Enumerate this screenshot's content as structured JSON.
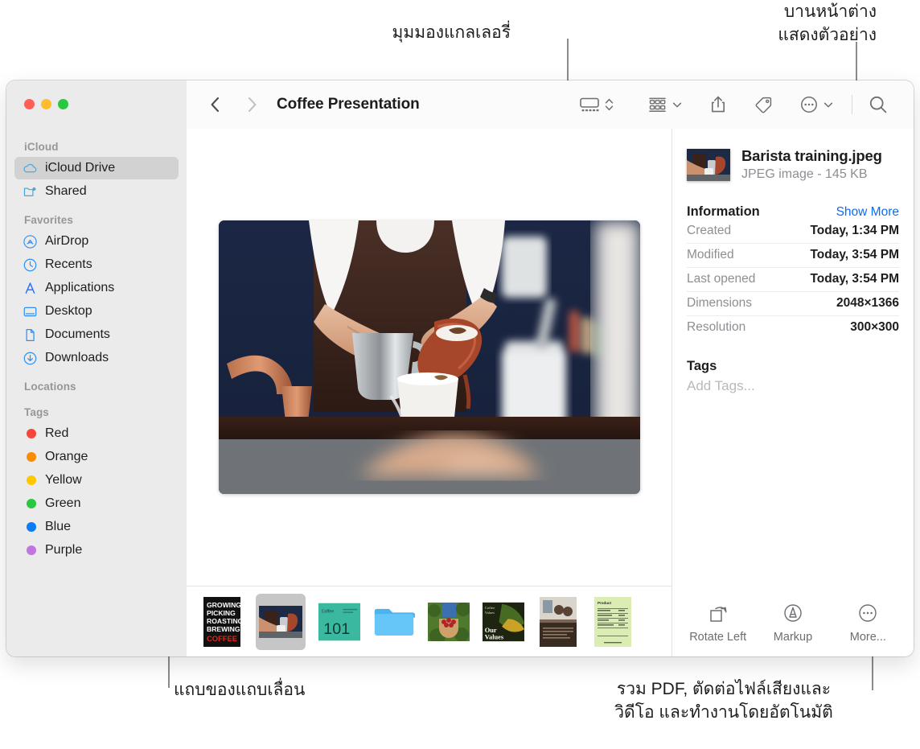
{
  "annotations": [
    {
      "id": "gallery-view",
      "text": "มุมมองแกลเลอรี่"
    },
    {
      "id": "preview-pane",
      "text": "บานหน้าต่าง\nแสดงตัวอย่าง"
    },
    {
      "id": "scrubber-bar",
      "text": "แถบของแถบเลื่อน"
    },
    {
      "id": "quick-actions",
      "text": "รวม PDF, ตัดต่อไฟล์เสียงและ\nวิดีโอ และทำงานโดยอัตโนมัติ"
    }
  ],
  "window": {
    "traffic_lights": [
      {
        "name": "close",
        "color": "#ff5f57"
      },
      {
        "name": "minimize",
        "color": "#febc2e"
      },
      {
        "name": "zoom",
        "color": "#28c840"
      }
    ]
  },
  "toolbar": {
    "back_icon": "chevron-left",
    "forward_icon": "chevron-right",
    "title": "Coffee Presentation",
    "view_icon": "gallery-view-icon",
    "view_stepper_icon": "up-down-chevrons",
    "group_icon": "group-items-icon",
    "share_icon": "share-icon",
    "tag_icon": "tag-icon",
    "more_icon": "ellipsis-circle-icon",
    "search_icon": "search-icon"
  },
  "sidebar": {
    "sections": [
      {
        "title": "iCloud",
        "items": [
          {
            "label": "iCloud Drive",
            "icon": "cloud-icon",
            "selected": true
          },
          {
            "label": "Shared",
            "icon": "shared-folder-icon",
            "selected": false
          }
        ]
      },
      {
        "title": "Favorites",
        "items": [
          {
            "label": "AirDrop",
            "icon": "airdrop-icon",
            "selected": false
          },
          {
            "label": "Recents",
            "icon": "clock-icon",
            "selected": false
          },
          {
            "label": "Applications",
            "icon": "applications-icon",
            "selected": false
          },
          {
            "label": "Desktop",
            "icon": "desktop-icon",
            "selected": false
          },
          {
            "label": "Documents",
            "icon": "document-icon",
            "selected": false
          },
          {
            "label": "Downloads",
            "icon": "downloads-icon",
            "selected": false
          }
        ]
      },
      {
        "title": "Locations",
        "items": []
      },
      {
        "title": "Tags",
        "items": [
          {
            "label": "Red",
            "icon": "tag-dot",
            "color": "#f7453c"
          },
          {
            "label": "Orange",
            "icon": "tag-dot",
            "color": "#fb8c00"
          },
          {
            "label": "Yellow",
            "icon": "tag-dot",
            "color": "#fdc800"
          },
          {
            "label": "Green",
            "icon": "tag-dot",
            "color": "#28c840"
          },
          {
            "label": "Blue",
            "icon": "tag-dot",
            "color": "#0a7cf5"
          },
          {
            "label": "Purple",
            "icon": "tag-dot",
            "color": "#c175e0"
          }
        ]
      }
    ]
  },
  "gallery": {
    "hero_alt": "barista-pouring-coffee",
    "thumbnails": [
      {
        "name": "growing-picking-roasting-brewing-coffee-poster",
        "selected": false
      },
      {
        "name": "barista-training-photo",
        "selected": true
      },
      {
        "name": "coffee-101-slide",
        "selected": false
      },
      {
        "name": "blue-folder",
        "selected": false
      },
      {
        "name": "coffee-cherries-harvest-photo",
        "selected": false
      },
      {
        "name": "our-values-slide",
        "selected": false
      },
      {
        "name": "cafe-meeting-document",
        "selected": false
      },
      {
        "name": "product-spreadsheet",
        "selected": false
      }
    ]
  },
  "info_panel": {
    "file_name": "Barista training.jpeg",
    "file_meta": "JPEG image - 145 KB",
    "information_title": "Information",
    "show_more": "Show More",
    "rows": [
      {
        "key": "Created",
        "value": "Today, 1:34 PM"
      },
      {
        "key": "Modified",
        "value": "Today, 3:54 PM"
      },
      {
        "key": "Last opened",
        "value": "Today, 3:54 PM"
      },
      {
        "key": "Dimensions",
        "value": "2048×1366"
      },
      {
        "key": "Resolution",
        "value": "300×300"
      }
    ],
    "tags_title": "Tags",
    "add_tags_placeholder": "Add Tags...",
    "quick_actions": [
      {
        "label": "Rotate Left",
        "icon": "rotate-left-icon"
      },
      {
        "label": "Markup",
        "icon": "markup-icon"
      },
      {
        "label": "More...",
        "icon": "ellipsis-circle-icon"
      }
    ]
  },
  "colors": {
    "accent_blue": "#0a6cf5",
    "sidebar_bg": "#ebebeb",
    "toolbar_bg": "#fbfbfb",
    "selection": "#d2d2d2"
  }
}
